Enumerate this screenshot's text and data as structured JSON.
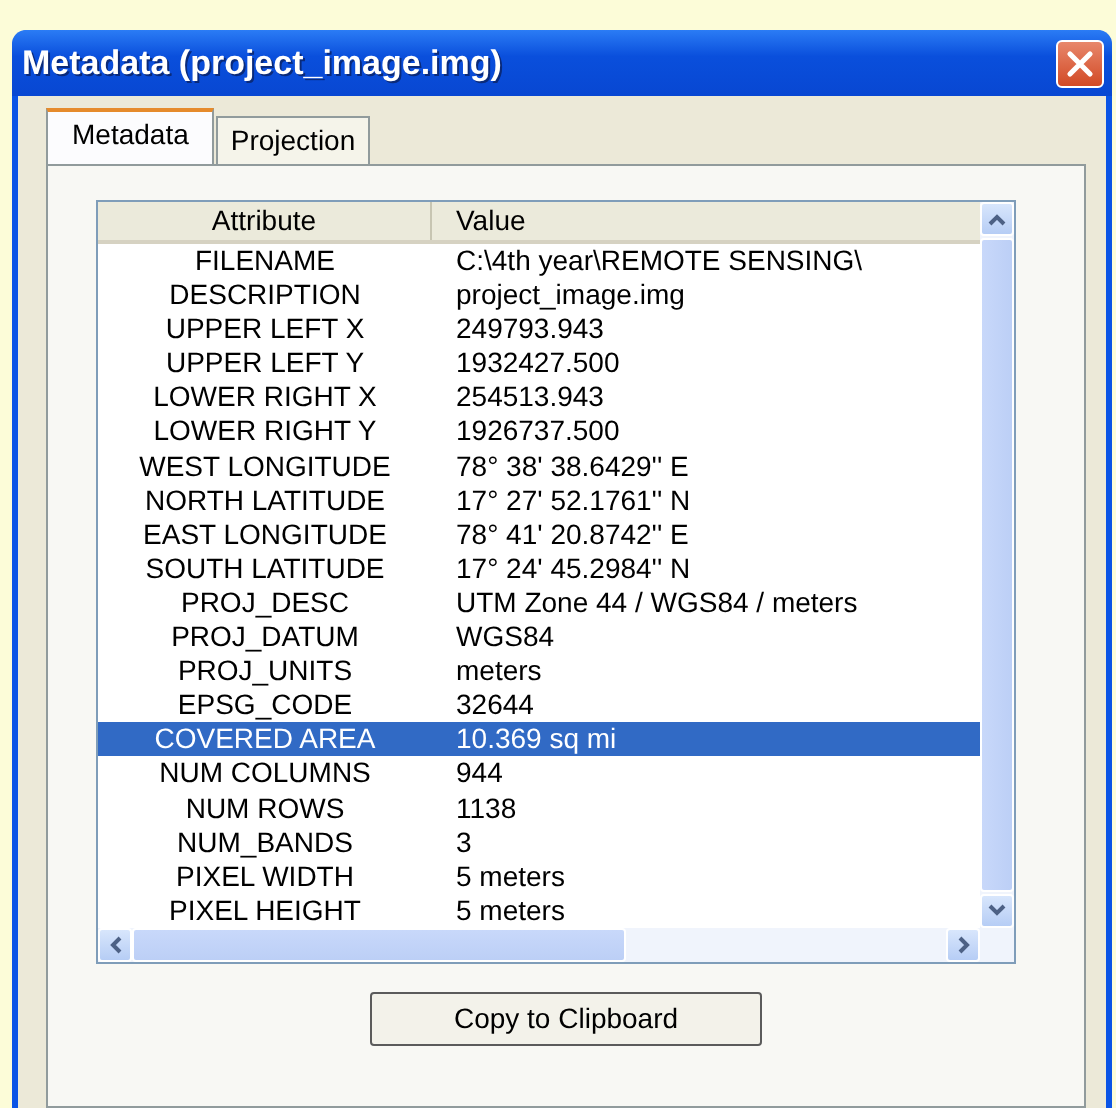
{
  "window": {
    "title": "Metadata (project_image.img)"
  },
  "tabs": [
    {
      "label": "Metadata",
      "selected": true
    },
    {
      "label": "Projection",
      "selected": false
    }
  ],
  "table": {
    "columns": [
      "Attribute",
      "Value"
    ],
    "rows": [
      {
        "attribute": "FILENAME",
        "value": "C:\\4th year\\REMOTE SENSING\\",
        "selected": false
      },
      {
        "attribute": "DESCRIPTION",
        "value": "project_image.img",
        "selected": false
      },
      {
        "attribute": "UPPER LEFT X",
        "value": "249793.943",
        "selected": false
      },
      {
        "attribute": "UPPER LEFT Y",
        "value": "1932427.500",
        "selected": false
      },
      {
        "attribute": "LOWER RIGHT X",
        "value": "254513.943",
        "selected": false
      },
      {
        "attribute": "LOWER RIGHT Y",
        "value": "1926737.500",
        "selected": false
      },
      {
        "attribute": "WEST LONGITUDE",
        "value": "78° 38' 38.6429'' E",
        "selected": false
      },
      {
        "attribute": "NORTH LATITUDE",
        "value": "17° 27' 52.1761'' N",
        "selected": false
      },
      {
        "attribute": "EAST LONGITUDE",
        "value": "78° 41' 20.8742'' E",
        "selected": false
      },
      {
        "attribute": "SOUTH LATITUDE",
        "value": "17° 24' 45.2984'' N",
        "selected": false
      },
      {
        "attribute": "PROJ_DESC",
        "value": "UTM Zone 44 / WGS84 / meters",
        "selected": false
      },
      {
        "attribute": "PROJ_DATUM",
        "value": "WGS84",
        "selected": false
      },
      {
        "attribute": "PROJ_UNITS",
        "value": "meters",
        "selected": false
      },
      {
        "attribute": "EPSG_CODE",
        "value": "32644",
        "selected": false
      },
      {
        "attribute": "COVERED AREA",
        "value": "10.369 sq mi",
        "selected": true
      },
      {
        "attribute": "NUM COLUMNS",
        "value": "944",
        "selected": false
      },
      {
        "attribute": "NUM ROWS",
        "value": "1138",
        "selected": false
      },
      {
        "attribute": "NUM_BANDS",
        "value": "3",
        "selected": false
      },
      {
        "attribute": "PIXEL WIDTH",
        "value": "5 meters",
        "selected": false
      },
      {
        "attribute": "PIXEL HEIGHT",
        "value": "5 meters",
        "selected": false
      }
    ]
  },
  "buttons": [
    "Copy to Clipboard"
  ]
}
